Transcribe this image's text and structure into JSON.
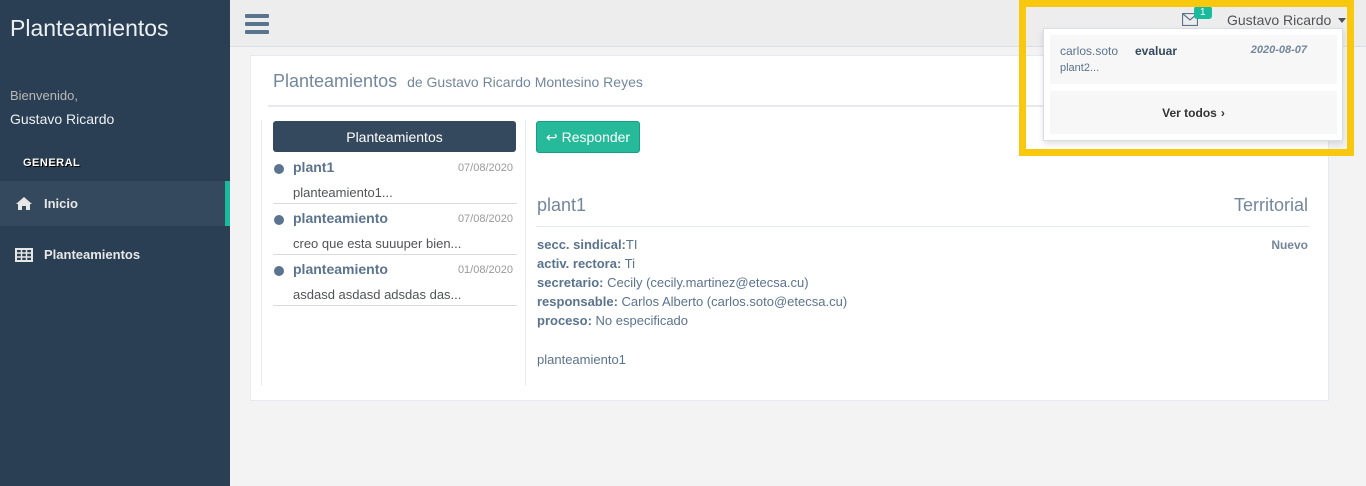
{
  "sidebar": {
    "app_title": "Planteamientos",
    "welcome": "Bienvenido,",
    "user": "Gustavo Ricardo",
    "section": "GENERAL",
    "items": [
      {
        "label": "Inicio",
        "icon": "home-icon",
        "active": true
      },
      {
        "label": "Planteamientos",
        "icon": "table-icon",
        "active": false
      }
    ]
  },
  "topbar": {
    "mail_count": "1",
    "user": "Gustavo Ricardo"
  },
  "panel": {
    "title": "Planteamientos",
    "subtitle": "de Gustavo Ricardo Montesino Reyes"
  },
  "list": {
    "header": "Planteamientos",
    "items": [
      {
        "subject": "plant1",
        "date": "07/08/2020",
        "preview": "planteamiento1..."
      },
      {
        "subject": "planteamiento",
        "date": "07/08/2020",
        "preview": "creo que esta suuuper bien..."
      },
      {
        "subject": "planteamiento",
        "date": "01/08/2020",
        "preview": "asdasd asdasd adsdas das..."
      }
    ]
  },
  "detail": {
    "reply_label": "Responder",
    "title": "plant1",
    "category": "Territorial",
    "status": "Nuevo",
    "fields": [
      {
        "label": "secc. sindical:",
        "value": "TI"
      },
      {
        "label": "activ. rectora:",
        "value": " Ti"
      },
      {
        "label": "secretario:",
        "value": " Cecily (cecily.martinez@etecsa.cu)"
      },
      {
        "label": "responsable:",
        "value": " Carlos Alberto (carlos.soto@etecsa.cu)"
      },
      {
        "label": "proceso:",
        "value": " No especificado"
      }
    ],
    "body": "planteamiento1"
  },
  "dropdown": {
    "sender": "carlos.soto",
    "tag": "evaluar",
    "time": "2020-08-07",
    "message": "plant2...",
    "see_all": "Ver todos"
  },
  "colors": {
    "sidebar_bg": "#2a3f54",
    "accent": "#1abb9c",
    "highlight": "#f8c80f"
  }
}
